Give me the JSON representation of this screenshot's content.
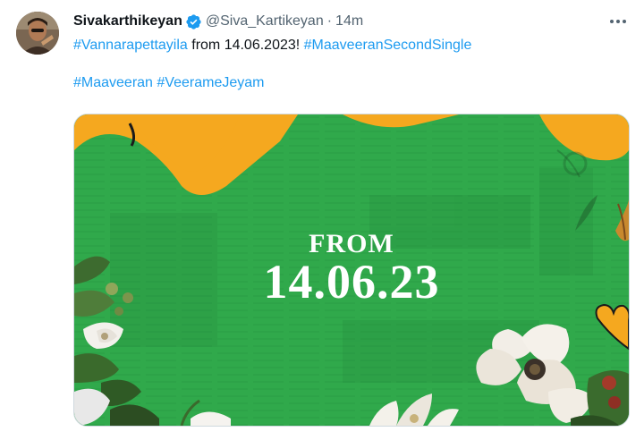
{
  "tweet": {
    "author_name": "Sivakarthikeyan",
    "author_handle": "@Siva_Kartikeyan",
    "separator": "·",
    "timestamp": "14m",
    "verified": true,
    "text": {
      "hashtag1": "#Vannarapettayila",
      "plain1": " from 14.06.2023! ",
      "hashtag2": "#MaaveeranSecondSingle",
      "hashtag3": "#Maaveeran",
      "hashtag4": "#VeerameJeyam"
    },
    "media": {
      "from_label": "FROM",
      "date_label": "14.06.23"
    }
  },
  "colors": {
    "hashtag": "#1d9bf0",
    "verified_badge": "#1d9bf0",
    "poster_green": "#2fa84a",
    "poster_orange": "#f5a81f"
  },
  "icons": {
    "verified": "verified-badge-icon",
    "more": "more-options-icon"
  }
}
